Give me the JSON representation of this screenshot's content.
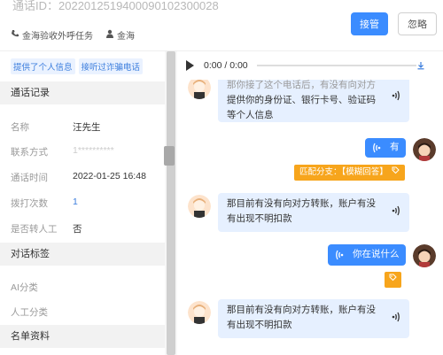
{
  "header": {
    "call_id_label": "通话ID：2022012519400090102300028",
    "task_name": "金海验收外呼任务",
    "agent_name": "金海",
    "accept_label": "接管",
    "ignore_label": "忽略"
  },
  "left": {
    "tags": [
      "提供了个人信息",
      "接听过诈骗电话"
    ],
    "sections": {
      "call_record": "通话记录",
      "dialog_tags": "对话标签",
      "list_data": "名单资料"
    },
    "fields": [
      {
        "label": "名称",
        "value": "汪先生"
      },
      {
        "label": "联系方式",
        "value": "1**********"
      },
      {
        "label": "通话时间",
        "value": "2022-01-25 16:48"
      },
      {
        "label": "拨打次数",
        "value": "1"
      },
      {
        "label": "是否转人工",
        "value": "否"
      }
    ],
    "ai_class": "AI分类",
    "manual_class": "人工分类"
  },
  "player": {
    "time": "0:00 / 0:00"
  },
  "chat": {
    "messages": [
      {
        "side": "left",
        "text": "那你接了这个电话后，有没有向对方提供你的身份证、银行卡号、验证码等个人信息"
      },
      {
        "side": "right",
        "text": "有",
        "match": "匹配分支：【模糊回答】"
      },
      {
        "side": "left",
        "text": "那目前有没有向对方转账，账户有没有出现不明扣款"
      },
      {
        "side": "right",
        "text": "你在说什么"
      },
      {
        "side": "left",
        "text": "那目前有没有向对方转账，账户有没有出现不明扣款"
      }
    ],
    "line1a": "那你接了这个电话后，有没有向对方",
    "line1b": "提供你的身份证、银行卡号、验证码",
    "line1c": "等个人信息",
    "msg2": "有",
    "match_label": "匹配分支：【模糊回答】",
    "line3a": "那目前有没有向对方转账，账户有没",
    "line3b": "有出现不明扣款",
    "msg4": "你在说什么",
    "line5a": "那目前有没有向对方转账，账户有没",
    "line5b": "有出现不明扣款"
  },
  "colors": {
    "primary": "#3b8cff",
    "bubble_left": "#e6f0ff",
    "match_orange": "#f7a51c"
  }
}
